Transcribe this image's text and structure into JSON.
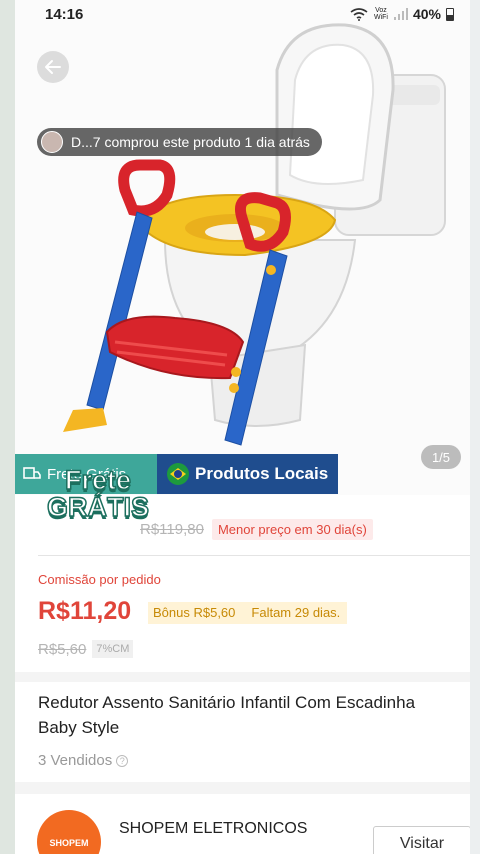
{
  "status_bar": {
    "time": "14:16",
    "network_label": "Voz\nWiFi",
    "battery": "40%"
  },
  "product": {
    "purchase_toast": "D...7 comprou este produto 1 dia atrás",
    "image_counter": "1/5",
    "banner_free_shipping": "Frete Grátis",
    "banner_local": "Produtos Locais",
    "frete_badge_line1": "Frete",
    "frete_badge_line2": "GRÁTIS",
    "old_price": "R$119,80",
    "lowest_price_badge": "Menor preço em 30 dia(s)",
    "commission_label": "Comissão por pedido",
    "commission_value": "R$11,20",
    "bonus_text": "Bônus R$5,60",
    "days_left_text": "Faltam 29 dias.",
    "sub_old_price": "R$5,60",
    "cm_badge": "7%CM",
    "title": "Redutor Assento Sanitário Infantil Com Escadinha Baby Style",
    "sold_count": "3 Vendidos",
    "info_glyph": "?"
  },
  "shop": {
    "logo_text": "SHOPEM",
    "name": "SHOPEM ELETRONICOS",
    "visit_label": "Visitar"
  },
  "colors": {
    "accent_red": "#e0453a",
    "free_shipping_teal": "#3ea79a",
    "local_blue": "#1f4d8e",
    "bonus_gold": "#c78a06",
    "shop_orange": "#f26a21"
  },
  "icons": {
    "back": "arrow-left-icon",
    "wifi": "wifi-icon",
    "signal": "signal-icon",
    "battery": "battery-icon",
    "truck": "truck-icon",
    "flag": "brazil-flag-icon",
    "info": "info-icon"
  }
}
